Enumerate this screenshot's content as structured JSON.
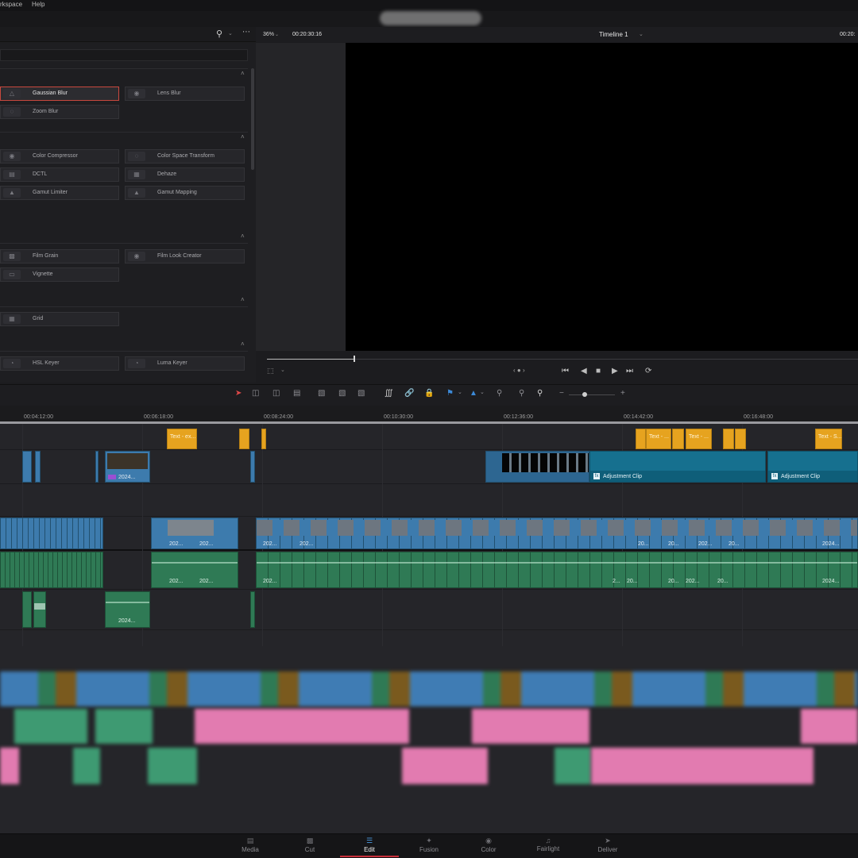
{
  "menu": {
    "workspace": "rkspace",
    "help": "Help"
  },
  "effects_panel": {
    "groups": [
      {
        "items": [
          "Gaussian Blur",
          "Lens Blur",
          "Zoom Blur"
        ],
        "selected": "Gaussian Blur"
      },
      {
        "items": [
          "Color Compressor",
          "Color Space Transform",
          "DCTL",
          "Dehaze",
          "Gamut Limiter",
          "Gamut Mapping"
        ]
      },
      {
        "items": [
          "Film Grain",
          "Film Look Creator",
          "Vignette"
        ]
      },
      {
        "items": [
          "Grid"
        ]
      },
      {
        "items": [
          "HSL Keyer",
          "Luma Keyer"
        ]
      }
    ]
  },
  "viewer": {
    "zoom": "36%",
    "timecode": "00:20:30:16",
    "timeline_name": "Timeline 1",
    "timecode_right": "00:20:"
  },
  "ruler": {
    "timecodes": [
      "00:04:12:00",
      "00:06:18:00",
      "00:08:24:00",
      "00:10:30:00",
      "00:12:36:00",
      "00:14:42:00",
      "00:16:48:00"
    ]
  },
  "clips": {
    "title_labels": [
      "Text - ex...",
      "Text - ...",
      "Text - ...",
      "Text - S..."
    ],
    "adjustment_label": "Adjustment Clip",
    "video_captions": [
      "2024...",
      "202...",
      "202...",
      "202...",
      "202...",
      "20...",
      "20...",
      "202...",
      "20...",
      "2024..."
    ],
    "audio_captions": [
      "202...",
      "202...",
      "202...",
      "2...",
      "20...",
      "20...",
      "202...",
      "20...",
      "2024...",
      "2024..."
    ]
  },
  "pages": [
    {
      "label": "Media",
      "icon": "media-icon"
    },
    {
      "label": "Cut",
      "icon": "cut-icon"
    },
    {
      "label": "Edit",
      "icon": "edit-icon",
      "active": true
    },
    {
      "label": "Fusion",
      "icon": "fusion-icon"
    },
    {
      "label": "Color",
      "icon": "color-icon"
    },
    {
      "label": "Fairlight",
      "icon": "fairlight-icon"
    },
    {
      "label": "Deliver",
      "icon": "deliver-icon"
    }
  ],
  "colors": {
    "accent_red": "#c72f3a",
    "title_clip": "#e6a31f",
    "video_clip": "#3d7bad",
    "audio_clip": "#2f7a55",
    "adjustment_clip": "#16708f",
    "active_page_icon": "#4d9be0"
  }
}
